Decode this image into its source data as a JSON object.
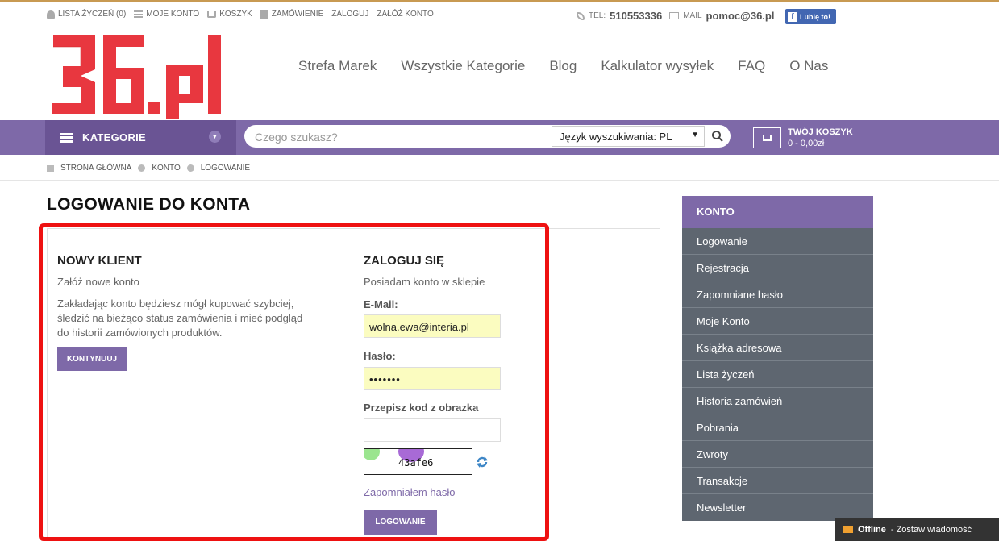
{
  "topbar": {
    "links": [
      "LISTA ŻYCZEŃ (0)",
      "MOJE KONTO",
      "KOSZYK",
      "ZAMÓWIENIE",
      "ZALOGUJ",
      "ZAŁÓŻ KONTO"
    ],
    "tel_label": "TEL:",
    "tel": "510553336",
    "mail_label": "MAIL",
    "mail": "pomoc@36.pl",
    "fb": "Lubię to!"
  },
  "logo": "36.pl",
  "nav": [
    "Strefa Marek",
    "Wszystkie Kategorie",
    "Blog",
    "Kalkulator wysyłek",
    "FAQ",
    "O Nas"
  ],
  "categories": "KATEGORIE",
  "search": {
    "placeholder": "Czego szukasz?",
    "lang": "Język wyszukiwania: PL"
  },
  "cart": {
    "title": "TWÓJ KOSZYK",
    "summary": "0 - 0,00zł"
  },
  "breadcrumb": [
    "STRONA GŁÓWNA",
    "KONTO",
    "LOGOWANIE"
  ],
  "page_title": "LOGOWANIE DO KONTA",
  "new_client": {
    "title": "NOWY KLIENT",
    "subtitle": "Załóż nowe konto",
    "desc_lines": [
      "Zakładając konto będziesz mógł kupować szybciej,",
      "śledzić na bieżąco status zamówienia i mieć podgląd",
      "do historii zamówionych produktów."
    ],
    "button": "KONTYNUUJ"
  },
  "login": {
    "title": "ZALOGUJ SIĘ",
    "subtitle": "Posiadam konto w sklepie",
    "email_label": "E-Mail:",
    "email_value": "wolna.ewa@interia.pl",
    "password_label": "Hasło:",
    "password_value": "•••••••",
    "captcha_label": "Przepisz kod z obrazka",
    "captcha_code": "43afe6",
    "forgot": "Zapomniałem hasło",
    "button": "LOGOWANIE"
  },
  "sidebar": {
    "title": "KONTO",
    "items": [
      "Logowanie",
      "Rejestracja",
      "Zapomniane hasło",
      "Moje Konto",
      "Książka adresowa",
      "Lista życzeń",
      "Historia zamówień",
      "Pobrania",
      "Zwroty",
      "Transakcje",
      "Newsletter"
    ]
  },
  "chat": {
    "status": "Offline",
    "text": "- Zostaw wiadomość"
  },
  "colors": {
    "accent": "#7e69a8",
    "logo_red": "#e8373f",
    "sidebar": "#5e6670",
    "highlight": "#ee1111"
  }
}
